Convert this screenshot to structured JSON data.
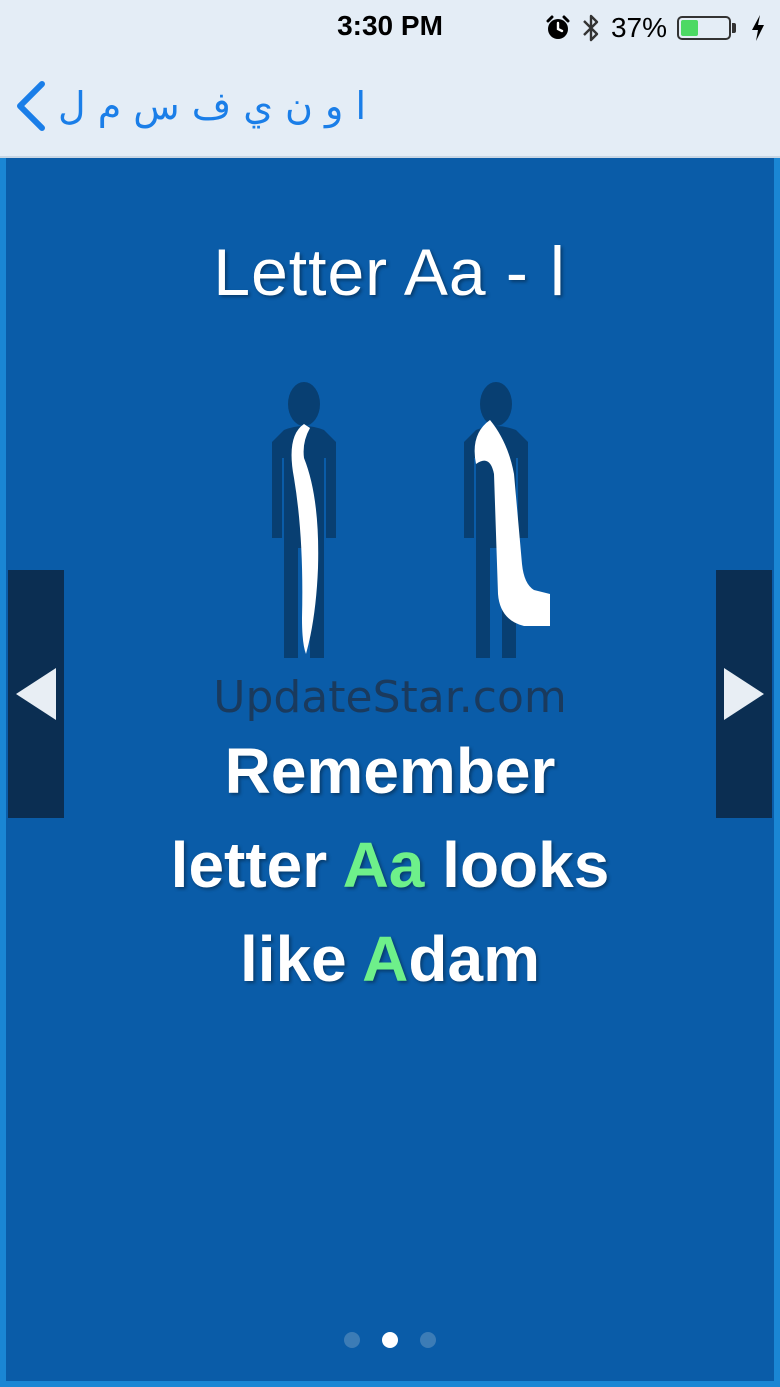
{
  "status_bar": {
    "time": "3:30 PM",
    "battery_percent": "37%",
    "battery_level": 0.37,
    "icons": [
      "alarm-icon",
      "bluetooth-icon",
      "battery-icon",
      "charging-icon"
    ]
  },
  "nav": {
    "back_label": "ا و ن ي ف س م ل",
    "accent_color": "#1a7ee8"
  },
  "card": {
    "title": "Letter Aa - ا",
    "watermark": "UpdateStar.com",
    "line1": "Remember",
    "line2_pre": "letter ",
    "line2_hl": "Aa",
    "line2_post": " looks",
    "line3_pre": "like ",
    "line3_hl": "A",
    "line3_post": "dam",
    "highlight_color": "#6ef08a"
  },
  "pager": {
    "count": 3,
    "active_index": 1
  }
}
